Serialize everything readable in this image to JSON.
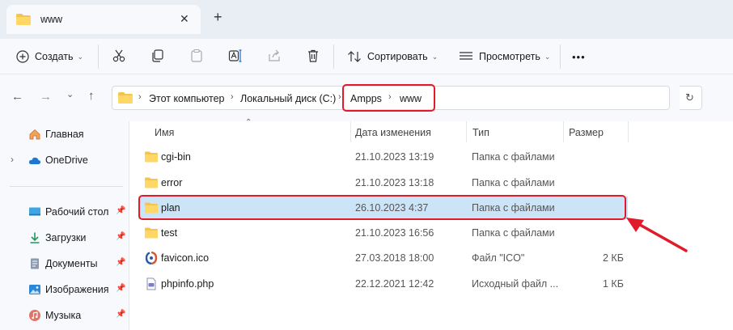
{
  "tab": {
    "title": "www",
    "close": "✕",
    "new": "+"
  },
  "toolbar": {
    "create": "Создать",
    "sort": "Сортировать",
    "view": "Просмотреть",
    "more": "•••"
  },
  "address": {
    "crumbs": [
      "Этот компьютер",
      "Локальный диск (C:)",
      "Ampps",
      "www"
    ]
  },
  "sidebar": {
    "items": [
      {
        "label": "Главная",
        "icon": "home-icon"
      },
      {
        "label": "OneDrive",
        "icon": "cloud-icon"
      },
      {
        "label": "Рабочий стол",
        "icon": "desktop-icon"
      },
      {
        "label": "Загрузки",
        "icon": "download-icon"
      },
      {
        "label": "Документы",
        "icon": "documents-icon"
      },
      {
        "label": "Изображения",
        "icon": "pictures-icon"
      },
      {
        "label": "Музыка",
        "icon": "music-icon"
      }
    ]
  },
  "columns": {
    "name": "Имя",
    "date": "Дата изменения",
    "type": "Тип",
    "size": "Размер"
  },
  "files": [
    {
      "name": "cgi-bin",
      "date": "21.10.2023 13:19",
      "type": "Папка с файлами",
      "size": "",
      "icon": "folder-icon"
    },
    {
      "name": "error",
      "date": "21.10.2023 13:18",
      "type": "Папка с файлами",
      "size": "",
      "icon": "folder-icon"
    },
    {
      "name": "plan",
      "date": "26.10.2023 4:37",
      "type": "Папка с файлами",
      "size": "",
      "icon": "folder-icon"
    },
    {
      "name": "test",
      "date": "21.10.2023 16:56",
      "type": "Папка с файлами",
      "size": "",
      "icon": "folder-icon"
    },
    {
      "name": "favicon.ico",
      "date": "27.03.2018 18:00",
      "type": "Файл \"ICO\"",
      "size": "2 КБ",
      "icon": "ico-file-icon"
    },
    {
      "name": "phpinfo.php",
      "date": "22.12.2021 12:42",
      "type": "Исходный файл ...",
      "size": "1 КБ",
      "icon": "php-file-icon"
    }
  ],
  "colors": {
    "highlight": "#e21b2b",
    "selected_row": "#cce4f7",
    "folder": "#f4c44e"
  }
}
